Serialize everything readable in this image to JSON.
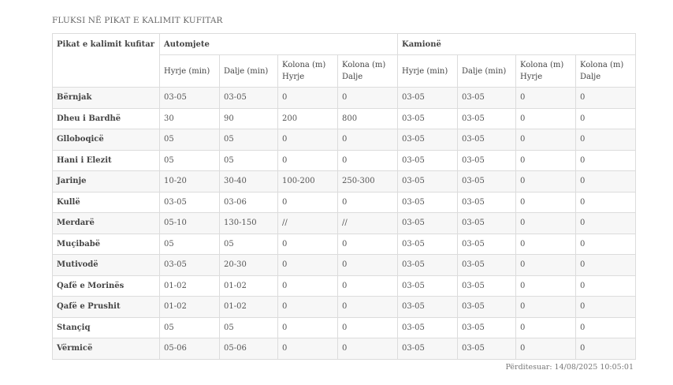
{
  "title": "FLUKSI NË PIKAT E KALIMIT KUFITAR",
  "table": {
    "corner_header": "Pikat e kalimit kufitar",
    "groups": [
      "Automjete",
      "Kamionë"
    ],
    "subheaders": [
      "Hyrje (min)",
      "Dalje (min)",
      "Kolona (m) Hyrje",
      "Kolona (m) Dalje",
      "Hyrje (min)",
      "Dalje (min)",
      "Kolona (m) Hyrje",
      "Kolona (m) Dalje"
    ],
    "rows": [
      [
        "Bërnjak",
        "03-05",
        "03-05",
        "0",
        "0",
        "03-05",
        "03-05",
        "0",
        "0"
      ],
      [
        "Dheu i Bardhë",
        "30",
        "90",
        "200",
        "800",
        "03-05",
        "03-05",
        "0",
        "0"
      ],
      [
        "Glloboqicë",
        "05",
        "05",
        "0",
        "0",
        "03-05",
        "03-05",
        "0",
        "0"
      ],
      [
        "Hani i Elezit",
        "05",
        "05",
        "0",
        "0",
        "03-05",
        "03-05",
        "0",
        "0"
      ],
      [
        "Jarinje",
        "10-20",
        "30-40",
        "100-200",
        "250-300",
        "03-05",
        "03-05",
        "0",
        "0"
      ],
      [
        "Kullë",
        "03-05",
        "03-06",
        "0",
        "0",
        "03-05",
        "03-05",
        "0",
        "0"
      ],
      [
        "Merdarë",
        "05-10",
        "130-150",
        "//",
        "//",
        "03-05",
        "03-05",
        "0",
        "0"
      ],
      [
        "Muçibabë",
        "05",
        "05",
        "0",
        "0",
        "03-05",
        "03-05",
        "0",
        "0"
      ],
      [
        "Mutivodë",
        "03-05",
        "20-30",
        "0",
        "0",
        "03-05",
        "03-05",
        "0",
        "0"
      ],
      [
        "Qafë e Morinës",
        "01-02",
        "01-02",
        "0",
        "0",
        "03-05",
        "03-05",
        "0",
        "0"
      ],
      [
        "Qafë e Prushit",
        "01-02",
        "01-02",
        "0",
        "0",
        "03-05",
        "03-05",
        "0",
        "0"
      ],
      [
        "Stançiq",
        "05",
        "05",
        "0",
        "0",
        "03-05",
        "03-05",
        "0",
        "0"
      ],
      [
        "Vërmicë",
        "05-06",
        "05-06",
        "0",
        "0",
        "03-05",
        "03-05",
        "0",
        "0"
      ]
    ]
  },
  "updated": "Përditesuar: 14/08/2025 10:05:01"
}
